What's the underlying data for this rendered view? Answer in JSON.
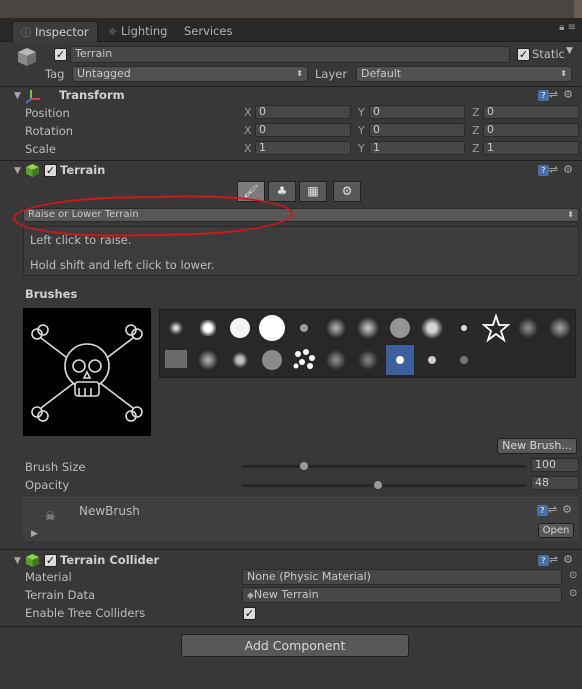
{
  "tabs": [
    {
      "label": "Inspector",
      "icon": "info-icon"
    },
    {
      "label": "Lighting",
      "icon": "lighting-icon"
    },
    {
      "label": "Services"
    }
  ],
  "header": {
    "object_name": "Terrain",
    "static_label": "Static",
    "tag_label": "Tag",
    "tag_value": "Untagged",
    "layer_label": "Layer",
    "layer_value": "Default"
  },
  "transform": {
    "title": "Transform",
    "rows": [
      {
        "label": "Position",
        "x": "0",
        "y": "0",
        "z": "0"
      },
      {
        "label": "Rotation",
        "x": "0",
        "y": "0",
        "z": "0"
      },
      {
        "label": "Scale",
        "x": "1",
        "y": "1",
        "z": "1"
      }
    ],
    "axis_labels": {
      "x": "X",
      "y": "Y",
      "z": "Z"
    }
  },
  "terrain": {
    "title": "Terrain",
    "tool_dropdown": "Raise or Lower Terrain",
    "help_line1": "Left click to raise.",
    "help_line2": "Hold shift and left click to lower.",
    "brushes_label": "Brushes",
    "new_brush_button": "New Brush...",
    "brush_size_label": "Brush Size",
    "brush_size_value": "100",
    "brush_size_fraction": 0.22,
    "opacity_label": "Opacity",
    "opacity_value": "48",
    "opacity_fraction": 0.48,
    "brush_asset_name": "NewBrush",
    "open_button": "Open"
  },
  "collider": {
    "title": "Terrain Collider",
    "material_label": "Material",
    "material_value": "None (Physic Material)",
    "terrain_data_label": "Terrain Data",
    "terrain_data_value": "New Terrain",
    "trees_label": "Enable Tree Colliders"
  },
  "add_component_label": "Add Component",
  "colors": {
    "accent_selection": "#3d5f9c",
    "annotation_red": "#d01818"
  }
}
